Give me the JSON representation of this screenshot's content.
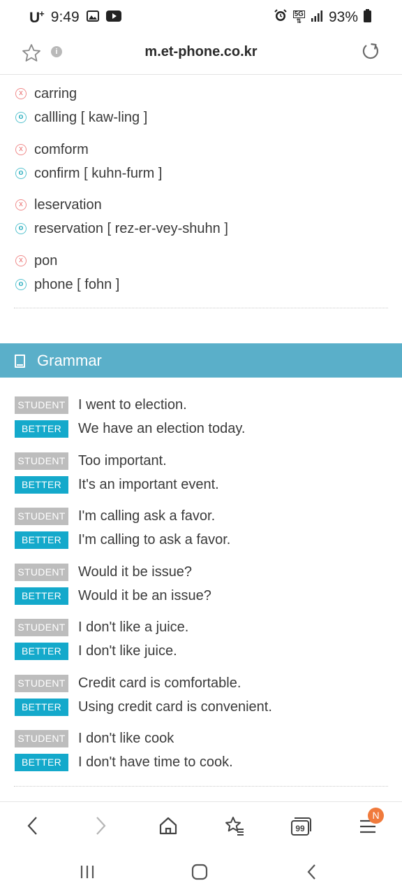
{
  "status_bar": {
    "carrier": "U",
    "carrier_sup": "+",
    "time": "9:49",
    "network": "5G",
    "battery": "93%"
  },
  "browser": {
    "url": "m.et-phone.co.kr",
    "info_icon": "i",
    "tab_count": "99",
    "notification_badge": "N"
  },
  "marks": {
    "wrong": "x",
    "right": "o"
  },
  "pronunciation": [
    {
      "wrong": "carring",
      "correct": "callling [ kaw-ling ]"
    },
    {
      "wrong": "comform",
      "correct": "confirm [ kuhn-furm ]"
    },
    {
      "wrong": "leservation",
      "correct": "reservation [ rez-er-vey-shuhn ]"
    },
    {
      "wrong": "pon",
      "correct": "phone [ fohn ]"
    }
  ],
  "grammar": {
    "title": "Grammar",
    "student_label": "STUDENT",
    "better_label": "BETTER",
    "items": [
      {
        "student": "I went to election.",
        "better": "We have an election today."
      },
      {
        "student": "Too important.",
        "better": "It's an important event."
      },
      {
        "student": "I'm calling ask a favor.",
        "better": "I'm calling to ask a favor."
      },
      {
        "student": "Would it be issue?",
        "better": "Would it be an issue?"
      },
      {
        "student": "I don't like a juice.",
        "better": "I don't like juice."
      },
      {
        "student": "Credit card is comfortable.",
        "better": "Using credit card is convenient."
      },
      {
        "student": "I don't like cook",
        "better": "I don't have time to cook."
      }
    ]
  },
  "icons": {
    "favorite": "star-outline-icon",
    "reload": "reload-icon",
    "back": "chevron-left-icon",
    "forward": "chevron-right-icon",
    "home": "home-icon",
    "bookmarks": "star-list-icon",
    "tabs": "tabs-icon",
    "menu": "hamburger-icon"
  },
  "colors": {
    "grammar_header": "#5aafc9",
    "better_badge": "#14a9cb",
    "student_badge": "#bdbdbd",
    "wrong_mark": "#e86a6a",
    "right_mark": "#2fb0c0",
    "notification": "#f07a3c"
  }
}
